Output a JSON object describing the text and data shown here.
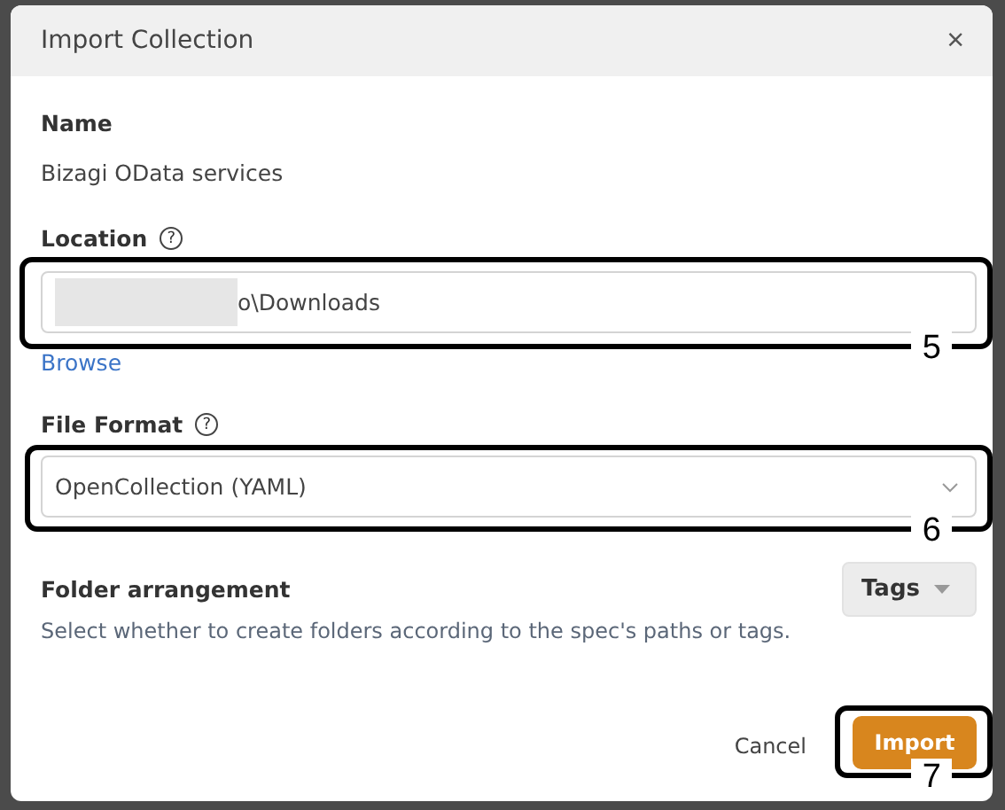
{
  "dialog": {
    "title": "Import Collection",
    "close": "×"
  },
  "name": {
    "label": "Name",
    "value": "Bizagi OData services"
  },
  "location": {
    "label": "Location",
    "help": "?",
    "value": "o\\Downloads",
    "redacted": true,
    "link": "Browse",
    "callout": "5"
  },
  "file_format": {
    "label": "File Format",
    "help": "?",
    "value": "OpenCollection (YAML)",
    "callout": "6"
  },
  "folder_arrangement": {
    "label": "Folder arrangement",
    "description": "Select whether to create folders according to the spec's paths or tags.",
    "value": "Tags"
  },
  "buttons": [
    {
      "label": "Cancel",
      "kind": "secondary"
    },
    {
      "label": "Import",
      "kind": "primary",
      "callout": "7"
    }
  ]
}
